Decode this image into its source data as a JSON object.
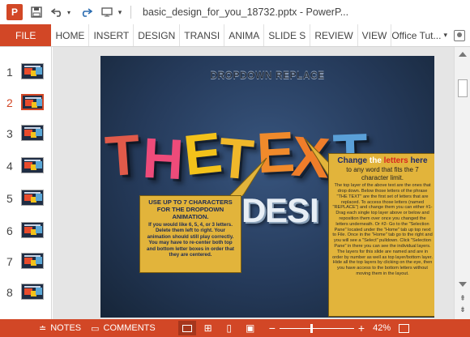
{
  "titlebar": {
    "app_icon_letter": "P",
    "doc_title": "basic_design_for_you_18732.pptx - PowerP..."
  },
  "ribbon": {
    "file_label": "FILE",
    "tabs": [
      "HOME",
      "INSERT",
      "DESIGN",
      "TRANSI",
      "ANIMA",
      "SLIDE S",
      "REVIEW",
      "VIEW"
    ],
    "user_label": "Office Tut..."
  },
  "thumbnails": [
    {
      "number": "1",
      "active": false
    },
    {
      "number": "2",
      "active": true
    },
    {
      "number": "3",
      "active": false
    },
    {
      "number": "4",
      "active": false
    },
    {
      "number": "5",
      "active": false
    },
    {
      "number": "6",
      "active": false
    },
    {
      "number": "7",
      "active": false
    },
    {
      "number": "8",
      "active": false
    }
  ],
  "slide": {
    "title": "DROPDOWN REPLACE",
    "big_text": "THETEXT",
    "small_text": "IS DESIGN",
    "callout_left": {
      "heading": "USE UP TO 7 CHARACTERS FOR THE DROPDOWN ANIMATION.",
      "body": "If you would like 6, 5, 4, or 3 letters. Delete them left to right. Your animation should still play correctly. You may have to re-center both top and bottom letter boxes in order that they are centered."
    },
    "callout_right": {
      "heading_prefix": "Change ",
      "heading_the": "the",
      "heading_letters": "letters",
      "heading_suffix": " here",
      "sub": "to any word that fits the 7 character limit.",
      "body": "The top layer of the above text are the ones that drop down. Below those letters of the phrase \"THE TEXT\" are the first set of letters that are replaced. To access those letters (named \"REPLACE\") and change them you can either #1- Drag each single top layer above or below and reposition them over once you changed the letters underneath. Or #2- Go to the \"Selection Pane\" located under the \"Home\" tab up top next to File. Once in the \"Home\" tab go to the right and you will see a \"Select\" pulldown. Click \"Selection Pane\" in there you can see the individual layers. The layers for this slide are named and are in order by number as well as top layer/bottom layer. Hide all the top layers by clicking on the eye, then you have access to the bottom letters without moving them in the layout."
    }
  },
  "statusbar": {
    "notes_label": "NOTES",
    "comments_label": "COMMENTS",
    "zoom_level": "42%",
    "zoom_fraction": 0.42
  },
  "colors": {
    "accent": "#d24726",
    "letter_t1": "#e05a4a",
    "letter_h": "#ee4b7a",
    "letter_e1": "#f3c21a",
    "letter_t2": "#f1b82a",
    "letter_e2": "#f08a2b",
    "letter_x": "#ef7d2a",
    "letter_t3": "#5aa0d8"
  }
}
